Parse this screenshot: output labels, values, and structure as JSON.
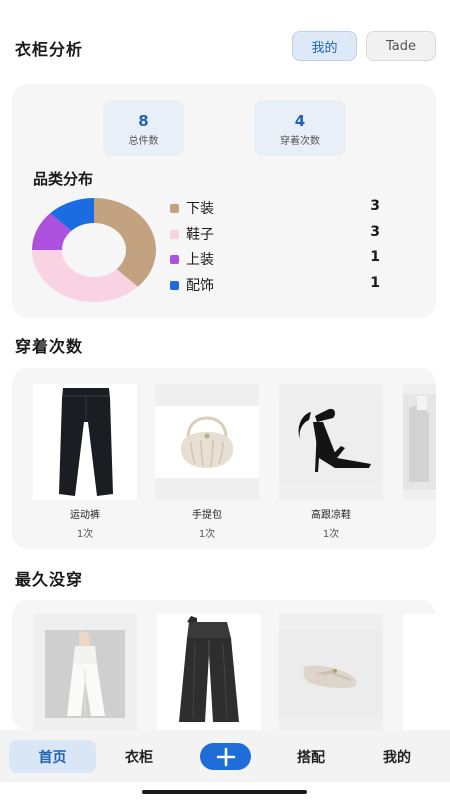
{
  "header": {
    "title": "衣柜分析",
    "toggle_mine": "我的",
    "toggle_tade": "Tade"
  },
  "stats": [
    {
      "value": "8",
      "label": "总件数"
    },
    {
      "value": "4",
      "label": "穿着次数"
    }
  ],
  "category": {
    "title": "品类分布",
    "items": [
      {
        "name": "下装",
        "count": "3",
        "color": "#c2a27f"
      },
      {
        "name": "鞋子",
        "count": "3",
        "color": "#f9d3e1"
      },
      {
        "name": "上装",
        "count": "1",
        "color": "#ad50dd"
      },
      {
        "name": "配饰",
        "count": "1",
        "color": "#1a6ce0"
      }
    ]
  },
  "wear_count": {
    "title": "穿着次数",
    "items": [
      {
        "name": "运动裤",
        "count": "1次",
        "icon": "pants-icon"
      },
      {
        "name": "手提包",
        "count": "1次",
        "icon": "handbag-icon"
      },
      {
        "name": "高跟凉鞋",
        "count": "1次",
        "icon": "heel-sandal-icon"
      }
    ]
  },
  "longest_unworn": {
    "title": "最久没穿",
    "items": [
      {
        "icon": "white-trousers-icon"
      },
      {
        "icon": "gray-trousers-icon"
      },
      {
        "icon": "mary-jane-shoe-icon"
      }
    ]
  },
  "nav": {
    "home": "首页",
    "wardrobe": "衣柜",
    "add_icon": "plus-icon",
    "outfit": "搭配",
    "mine": "我的"
  }
}
